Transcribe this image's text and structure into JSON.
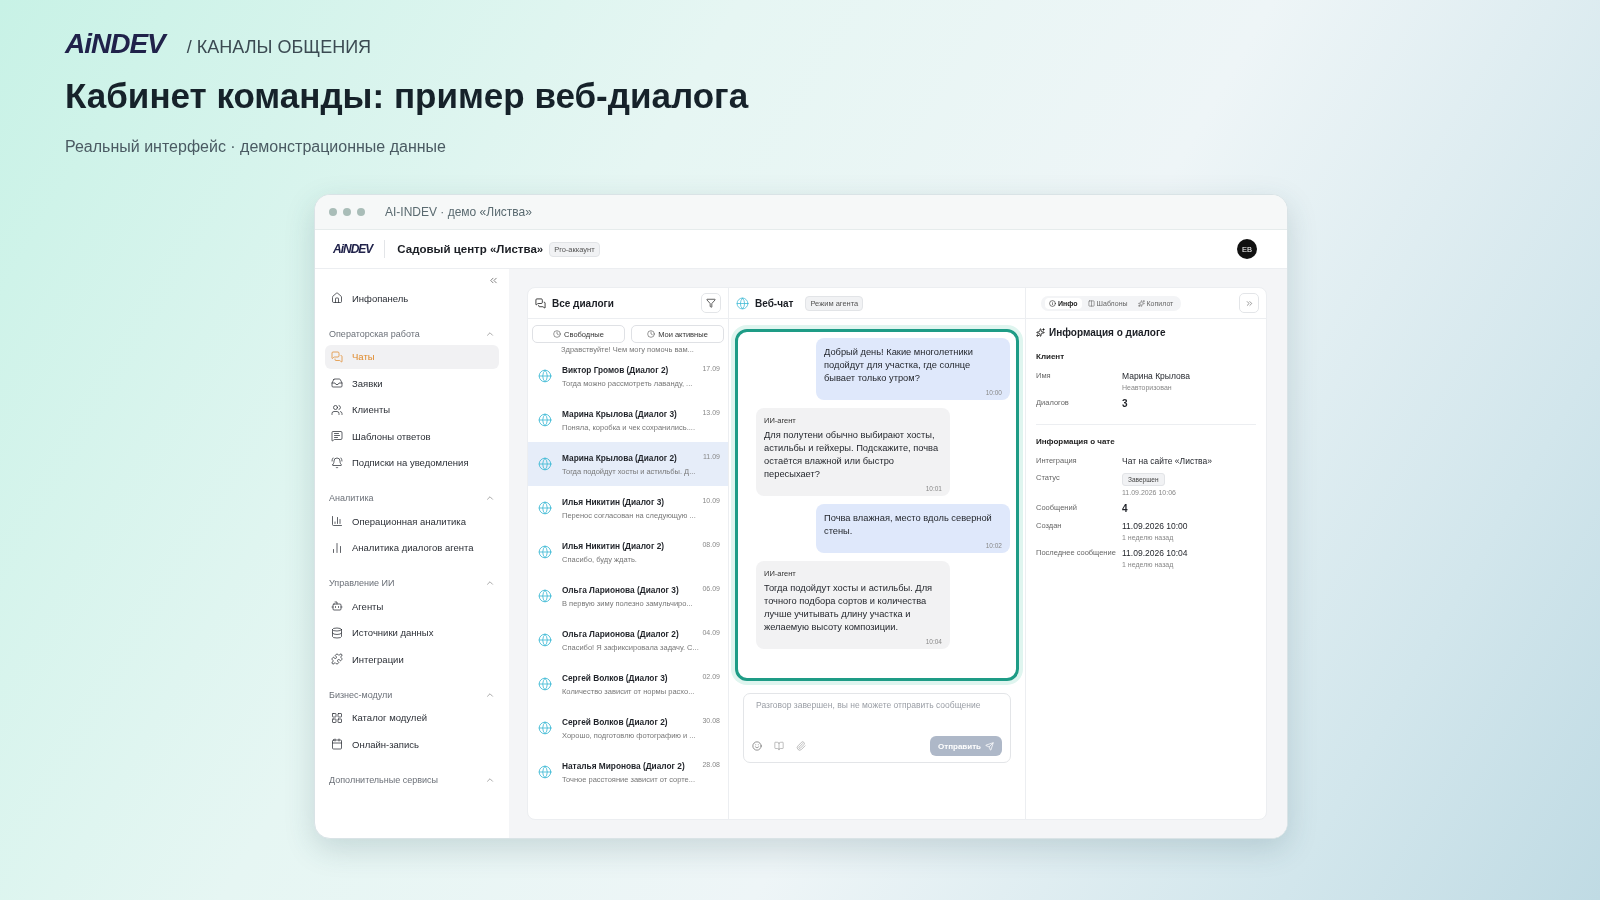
{
  "brand": {
    "logo": "AiNDEV",
    "section": "/ КАНАЛЫ ОБЩЕНИЯ"
  },
  "title": "Кабинет команды: пример веб-диалога",
  "subtitle": "Реальный интерфейс · демонстрационные данные",
  "window": {
    "title": "AI-INDEV · демо «Листва»"
  },
  "app_header": {
    "logo": "AiNDEV",
    "company": "Садовый центр «Листва»",
    "badge": "Pro-аккаунт",
    "avatar": "ЕВ"
  },
  "sidebar": {
    "top": {
      "label": "Инфопанель",
      "selected": false
    },
    "groups": [
      {
        "title": "Операторская работа",
        "expanded": true,
        "items": [
          {
            "label": "Чаты",
            "selected": true
          },
          {
            "label": "Заявки",
            "selected": false
          },
          {
            "label": "Клиенты",
            "selected": false
          },
          {
            "label": "Шаблоны ответов",
            "selected": false
          },
          {
            "label": "Подписки на уведомления",
            "selected": false
          }
        ]
      },
      {
        "title": "Аналитика",
        "expanded": true,
        "items": [
          {
            "label": "Операционная аналитика",
            "selected": false
          },
          {
            "label": "Аналитика диалогов агента",
            "selected": false
          }
        ]
      },
      {
        "title": "Управление ИИ",
        "expanded": true,
        "items": [
          {
            "label": "Агенты",
            "selected": false
          },
          {
            "label": "Источники данных",
            "selected": false
          },
          {
            "label": "Интеграции",
            "selected": false
          }
        ]
      },
      {
        "title": "Бизнес-модули",
        "expanded": true,
        "items": [
          {
            "label": "Каталог модулей",
            "selected": false
          },
          {
            "label": "Онлайн-запись",
            "selected": false
          }
        ]
      },
      {
        "title": "Дополнительные сервисы",
        "expanded": true
      }
    ]
  },
  "dialogs": {
    "title": "Все диалоги",
    "filters": [
      {
        "label": "Свободные",
        "selected": false
      },
      {
        "label": "Мои активные",
        "selected": false
      }
    ],
    "partial_preview": "Здравствуйте! Чем могу помочь вам...",
    "items": [
      {
        "name": "Виктор Громов (Диалог 2)",
        "date": "17.09",
        "preview": "Тогда можно рассмотреть лаванду, ...",
        "selected": false
      },
      {
        "name": "Марина Крылова (Диалог 3)",
        "date": "13.09",
        "preview": "Поняла, коробка и чек сохранились....",
        "selected": false
      },
      {
        "name": "Марина Крылова (Диалог 2)",
        "date": "11.09",
        "preview": "Тогда подойдут хосты и астильбы. Д...",
        "selected": true
      },
      {
        "name": "Илья Никитин (Диалог 3)",
        "date": "10.09",
        "preview": "Перенос согласован на следующую ...",
        "selected": false
      },
      {
        "name": "Илья Никитин (Диалог 2)",
        "date": "08.09",
        "preview": "Спасибо, буду ждать.",
        "selected": false
      },
      {
        "name": "Ольга Ларионова (Диалог 3)",
        "date": "06.09",
        "preview": "В первую зиму полезно замульчиро...",
        "selected": false
      },
      {
        "name": "Ольга Ларионова (Диалог 2)",
        "date": "04.09",
        "preview": "Спасибо! Я зафиксировала задачу. С...",
        "selected": false
      },
      {
        "name": "Сергей Волков (Диалог 3)",
        "date": "02.09",
        "preview": "Количество зависит от нормы расхо...",
        "selected": false
      },
      {
        "name": "Сергей Волков (Диалог 2)",
        "date": "30.08",
        "preview": "Хорошо, подготовлю фотографию и ...",
        "selected": false
      },
      {
        "name": "Наталья Миронова (Диалог 2)",
        "date": "28.08",
        "preview": "Точное расстояние зависит от сорте...",
        "selected": false
      }
    ]
  },
  "chat": {
    "title": "Веб-чат",
    "badge": "Режим агента",
    "messages": [
      {
        "kind": "client",
        "text": "Добрый день! Какие многолетники подойдут для участка, где солнце бывает только утром?",
        "time": "10:00"
      },
      {
        "kind": "agent",
        "author": "ИИ-агент",
        "text": "Для полутени обычно выбирают хосты, астильбы и гейхеры. Подскажите, почва остаётся влажной или быстро пересыхает?",
        "time": "10:01"
      },
      {
        "kind": "client",
        "text": "Почва влажная, место вдоль северной стены.",
        "time": "10:02"
      },
      {
        "kind": "agent",
        "author": "ИИ-агент",
        "text": "Тогда подойдут хосты и астильбы. Для точного подбора сортов и количества лучше учитывать длину участка и желаемую высоту композиции.",
        "time": "10:04"
      }
    ],
    "composer": {
      "placeholder": "Разговор завершен, вы не можете отправить сообщение",
      "disabled": true,
      "send": "Отправить"
    }
  },
  "info": {
    "tabs": [
      {
        "label": "Инфо",
        "selected": true
      },
      {
        "label": "Шаблоны",
        "selected": false
      },
      {
        "label": "Копилот",
        "selected": false
      }
    ],
    "title": "Информация о диалоге",
    "sections": [
      {
        "title": "Клиент",
        "rows": [
          {
            "kind": "text",
            "label": "Имя",
            "value": "Марина Крылова",
            "note": "Неавторизован"
          },
          {
            "kind": "number",
            "label": "Диалогов",
            "value": "3"
          }
        ]
      },
      {
        "title": "Информация о чате",
        "rows": [
          {
            "kind": "text",
            "label": "Интеграция",
            "value": "Чат на сайте «Листва»"
          },
          {
            "kind": "badge",
            "label": "Статус",
            "value": "Завершен",
            "note": "11.09.2026 10:06"
          },
          {
            "kind": "number",
            "label": "Сообщений",
            "value": "4"
          },
          {
            "kind": "text",
            "label": "Создан",
            "value": "11.09.2026 10:00",
            "note": "1 неделю назад"
          },
          {
            "kind": "text",
            "label": "Последнее сообщение",
            "value": "11.09.2026 10:04",
            "note": "1 неделю назад"
          }
        ]
      }
    ]
  }
}
